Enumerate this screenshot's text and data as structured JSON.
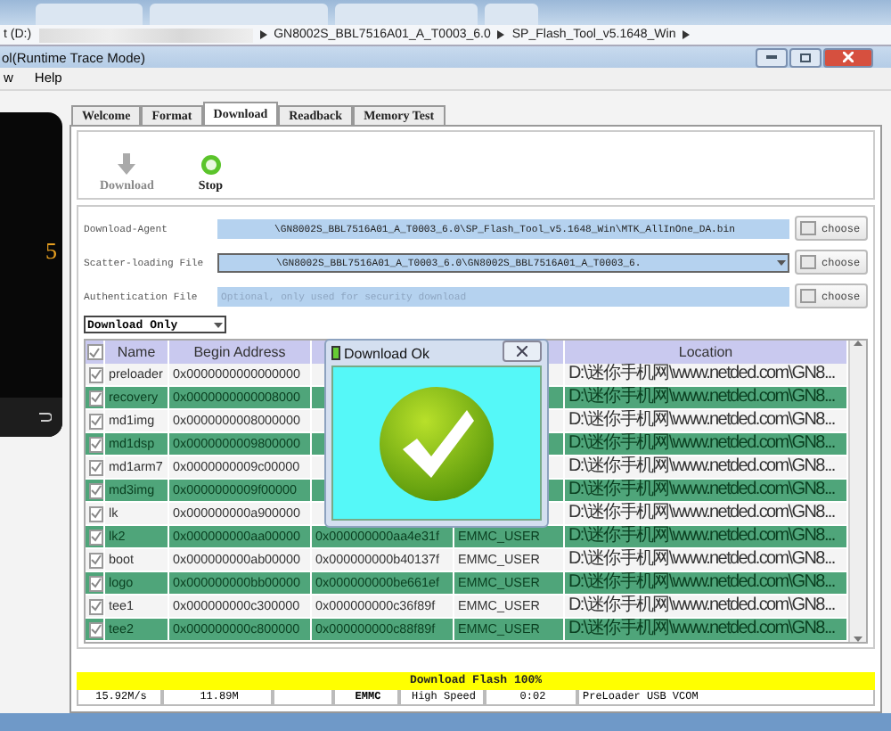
{
  "address_bar": {
    "segments": [
      "t (D:)",
      "GN8002S_BBL7516A01_A_T0003_6.0",
      "SP_Flash_Tool_v5.1648_Win"
    ]
  },
  "window": {
    "title": "ol(Runtime Trace Mode)"
  },
  "menu": [
    "w",
    "Help"
  ],
  "phone": {
    "digit": "5"
  },
  "tabs": [
    {
      "label": "Welcome",
      "selected": false
    },
    {
      "label": "Format",
      "selected": false
    },
    {
      "label": "Download",
      "selected": true
    },
    {
      "label": "Readback",
      "selected": false
    },
    {
      "label": "Memory Test",
      "selected": false
    }
  ],
  "toolbar": [
    {
      "label": "Download",
      "kind": "download",
      "disabled": true
    },
    {
      "label": "Stop",
      "kind": "stop",
      "disabled": false
    }
  ],
  "files": [
    {
      "label": "Download-Agent",
      "kind": "text",
      "value": "\\GN8002S_BBL7516A01_A_T0003_6.0\\SP_Flash_Tool_v5.1648_Win\\MTK_AllInOne_DA.bin",
      "button": "choose"
    },
    {
      "label": "Scatter-loading File",
      "kind": "combo",
      "value": "\\GN8002S_BBL7516A01_A_T0003_6.0\\GN8002S_BBL7516A01_A_T0003_6.",
      "button": "choose"
    },
    {
      "label": "Authentication File",
      "kind": "text",
      "placeholder": "Optional, only used for security download",
      "button": "choose"
    }
  ],
  "mode": {
    "value": "Download Only"
  },
  "table": {
    "all_checked": true,
    "header": {
      "name": "Name",
      "begin_address": "Begin Address",
      "location": "Location"
    },
    "rows": [
      {
        "checked": true,
        "selected": false,
        "name": "preloader",
        "begin": "0x0000000000000000",
        "location": "D:\\迷你手机网\\www.netded.com\\GN8..."
      },
      {
        "checked": true,
        "selected": true,
        "name": "recovery",
        "begin": "0x0000000000008000",
        "location": "D:\\迷你手机网\\www.netded.com\\GN8..."
      },
      {
        "checked": true,
        "selected": false,
        "name": "md1img",
        "begin": "0x0000000008000000",
        "location": "D:\\迷你手机网\\www.netded.com\\GN8..."
      },
      {
        "checked": true,
        "selected": true,
        "name": "md1dsp",
        "begin": "0x0000000009800000",
        "location": "D:\\迷你手机网\\www.netded.com\\GN8..."
      },
      {
        "checked": true,
        "selected": false,
        "name": "md1arm7",
        "begin": "0x0000000009c00000",
        "location": "D:\\迷你手机网\\www.netded.com\\GN8..."
      },
      {
        "checked": true,
        "selected": true,
        "name": "md3img",
        "begin": "0x0000000009f00000",
        "location": "D:\\迷你手机网\\www.netded.com\\GN8..."
      },
      {
        "checked": true,
        "selected": false,
        "name": "lk",
        "begin": "0x000000000a900000",
        "location": "D:\\迷你手机网\\www.netded.com\\GN8..."
      },
      {
        "checked": true,
        "selected": true,
        "name": "lk2",
        "begin": "0x000000000aa00000",
        "end": "0x000000000aa4e31f",
        "region": "EMMC_USER",
        "location": "D:\\迷你手机网\\www.netded.com\\GN8..."
      },
      {
        "checked": true,
        "selected": false,
        "name": "boot",
        "begin": "0x000000000ab00000",
        "end": "0x000000000b40137f",
        "region": "EMMC_USER",
        "location": "D:\\迷你手机网\\www.netded.com\\GN8..."
      },
      {
        "checked": true,
        "selected": true,
        "name": "logo",
        "begin": "0x000000000bb00000",
        "end": "0x000000000be661ef",
        "region": "EMMC_USER",
        "location": "D:\\迷你手机网\\www.netded.com\\GN8..."
      },
      {
        "checked": true,
        "selected": false,
        "name": "tee1",
        "begin": "0x000000000c300000",
        "end": "0x000000000c36f89f",
        "region": "EMMC_USER",
        "location": "D:\\迷你手机网\\www.netded.com\\GN8..."
      },
      {
        "checked": true,
        "selected": true,
        "name": "tee2",
        "begin": "0x000000000c800000",
        "end": "0x000000000c88f89f",
        "region": "EMMC_USER",
        "location": "D:\\迷你手机网\\www.netded.com\\GN8..."
      }
    ]
  },
  "dialog": {
    "title": "Download Ok"
  },
  "progress": {
    "label": "Download Flash 100%",
    "level": 1
  },
  "status": [
    {
      "kind": "text",
      "text": "15.92M/s",
      "bold": false
    },
    {
      "kind": "text",
      "text": "11.89M",
      "bold": false
    },
    {
      "kind": "blank"
    },
    {
      "kind": "text",
      "text": "EMMC",
      "bold": true
    },
    {
      "kind": "text",
      "text": "High Speed",
      "bold": false
    },
    {
      "kind": "text",
      "text": "0:02",
      "bold": false
    },
    {
      "kind": "text",
      "text": "PreLoader USB VCOM",
      "bold": false
    }
  ]
}
